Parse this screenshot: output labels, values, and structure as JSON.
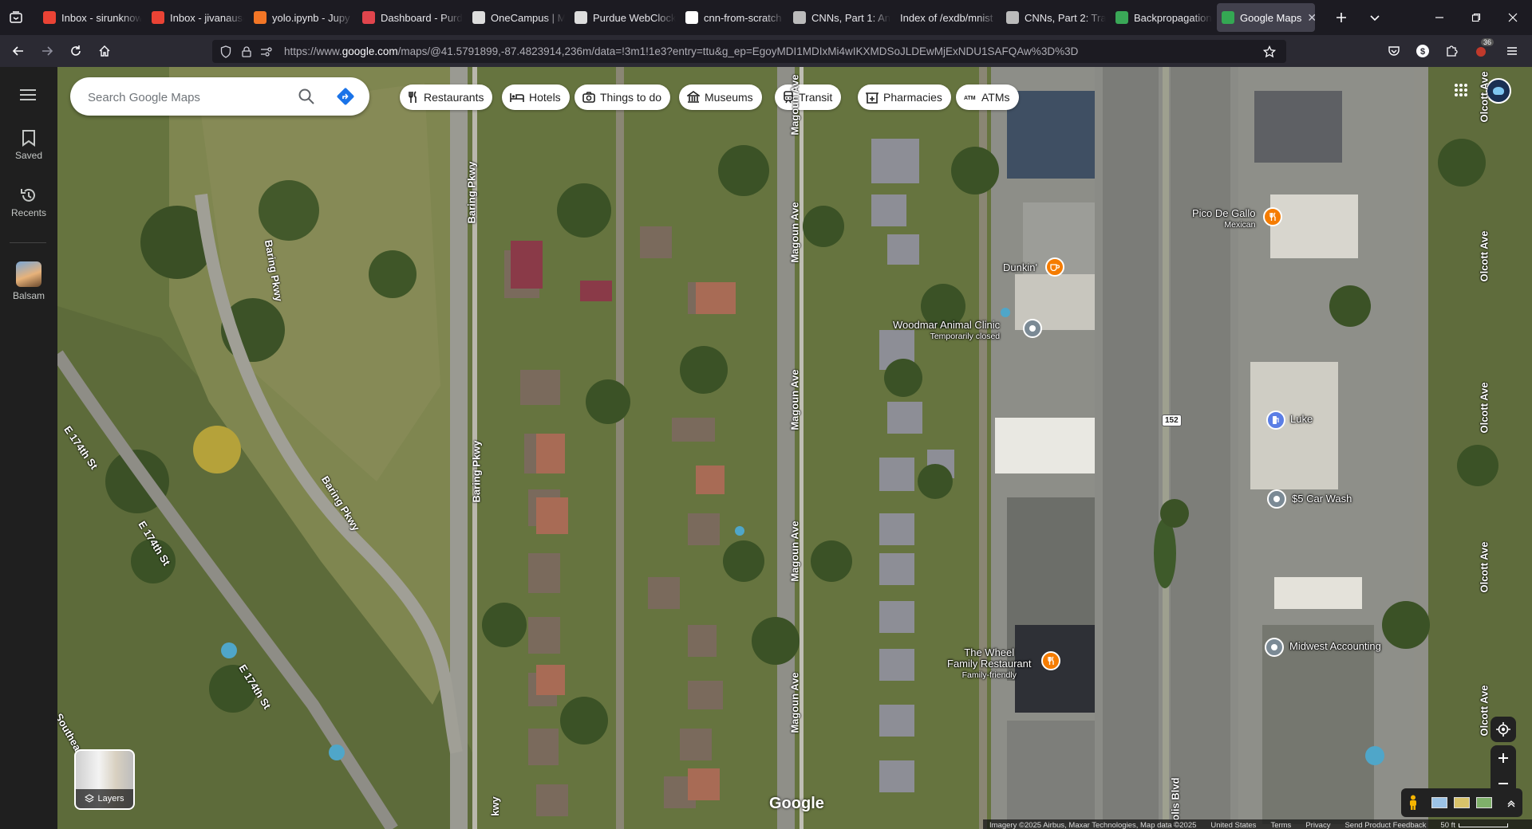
{
  "browser": {
    "tabs": [
      {
        "title": "Inbox - sirunknow",
        "icon": "gmail-icon",
        "color": "#ea4335"
      },
      {
        "title": "Inbox - jivanaus@",
        "icon": "gmail-icon",
        "color": "#ea4335"
      },
      {
        "title": "yolo.ipynb - Jupy",
        "icon": "jupyter-icon",
        "color": "#f37626"
      },
      {
        "title": "Dashboard - Purd",
        "icon": "purdue-icon",
        "color": "#e1454d"
      },
      {
        "title": "OneCampus | Mo",
        "icon": "onecampus-icon",
        "color": "#dddddd"
      },
      {
        "title": "Purdue WebClock",
        "icon": "purdue-icon",
        "color": "#dddddd"
      },
      {
        "title": "cnn-from-scratch",
        "icon": "github-icon",
        "color": "#ffffff"
      },
      {
        "title": "CNNs, Part 1: An",
        "icon": "victorzhou-icon",
        "color": "#bbbbbb"
      },
      {
        "title": "Index of /exdb/mnist",
        "icon": "none",
        "color": "#1c1b22"
      },
      {
        "title": "CNNs, Part 2: Trai",
        "icon": "victorzhou-icon",
        "color": "#bbbbbb"
      },
      {
        "title": "Backpropagation",
        "icon": "backprop-icon",
        "color": "#3aa757"
      },
      {
        "title": "Google Maps",
        "icon": "google-maps-icon",
        "color": "#34a853",
        "active": true
      }
    ],
    "url": {
      "prefix": "https://www.",
      "domain": "google.com",
      "rest": "/maps/@41.5791899,-87.4823914,236m/data=!3m1!1e3?entry=ttu&g_ep=EgoyMDI1MDIxMi4wIKXMDSoJLDEwMjExNDU1SAFQAw%3D%3D"
    },
    "extension_badge": "36"
  },
  "rail": {
    "saved": "Saved",
    "recents": "Recents",
    "recent_place": "Balsam"
  },
  "search": {
    "placeholder": "Search Google Maps"
  },
  "chips": [
    "Restaurants",
    "Hotels",
    "Things to do",
    "Museums",
    "Transit",
    "Pharmacies",
    "ATMs"
  ],
  "places": {
    "pico": {
      "name": "Pico De Gallo",
      "sub": "Mexican"
    },
    "dunkin": {
      "name": "Dunkin'"
    },
    "woodmar": {
      "name": "Woodmar Animal Clinic",
      "sub": "Temporarily closed"
    },
    "luke": {
      "name": "Luke"
    },
    "carwash": {
      "name": "$5 Car Wash"
    },
    "midwest": {
      "name": "Midwest Accounting"
    },
    "wheel": {
      "name1": "The Wheel",
      "name2": "Family Restaurant",
      "sub": "Family-friendly"
    }
  },
  "streets": {
    "baring": "Baring Pkwy",
    "magoun": "Magoun Ave",
    "olcott": "Olcott Ave",
    "e174": "E 174th St",
    "indianapolis": "polis Blvd",
    "southeast": "Southeas",
    "baring_partial": "kwy",
    "route": "152"
  },
  "map": {
    "layers_label": "Layers",
    "watermark": "Google",
    "footer": {
      "imagery": "Imagery ©2025 Airbus, Maxar Technologies, Map data ©2025",
      "country": "United States",
      "terms": "Terms",
      "privacy": "Privacy",
      "feedback": "Send Product Feedback",
      "scale": "50 ft"
    },
    "colors": {
      "pin_orange": "#f57c00",
      "pin_blue": "#5b7ee5",
      "pin_gray": "#7b8a95",
      "directions_blue": "#1a73e8"
    }
  }
}
